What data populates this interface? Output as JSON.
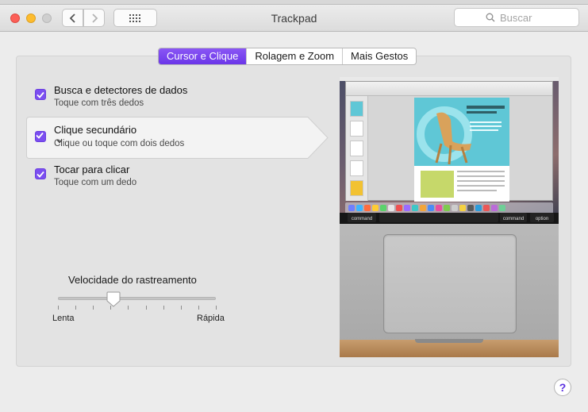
{
  "window": {
    "title": "Trackpad"
  },
  "toolbar": {
    "back_icon": "chevron-left-icon",
    "forward_icon": "chevron-right-icon",
    "grid_icon": "grid-icon",
    "search_placeholder": "Buscar"
  },
  "tabs": [
    {
      "label": "Cursor e Clique",
      "active": true
    },
    {
      "label": "Rolagem e Zoom",
      "active": false
    },
    {
      "label": "Mais Gestos",
      "active": false
    }
  ],
  "options": [
    {
      "title": "Busca e detectores de dados",
      "subtitle": "Toque com três dedos",
      "checked": true
    },
    {
      "title": "Clique secundário",
      "subtitle": "Clique ou toque com dois dedos",
      "checked": true,
      "selected": true
    },
    {
      "title": "Tocar para clicar",
      "subtitle": "Toque com um dedo",
      "checked": true
    }
  ],
  "tracking_speed": {
    "label": "Velocidade do rastreamento",
    "min_label": "Lenta",
    "max_label": "Rápida",
    "value_fraction": 0.35
  },
  "preview_keys": {
    "left": "command",
    "right": "command",
    "right2": "option"
  },
  "help": {
    "label": "?"
  },
  "colors": {
    "accent": "#7b4ef0",
    "panel": "#e3e3e3"
  }
}
